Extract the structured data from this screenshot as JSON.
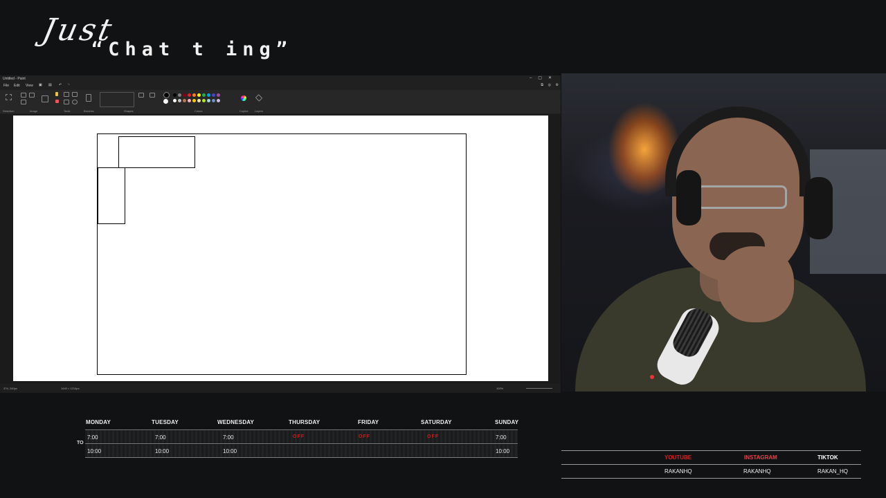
{
  "overlay": {
    "title_script": "Just",
    "title_main": "“Chat t ing”"
  },
  "paint": {
    "window_title": "Untitled - Paint",
    "menu": [
      "File",
      "Edit",
      "View"
    ],
    "ribbon_groups": [
      "Selection",
      "Image",
      "Tools",
      "Brushes",
      "Shapes",
      "Colors",
      "Copilot",
      "Layers"
    ],
    "status_position": "374, 240px",
    "status_size": "1440 × 1214px",
    "zoom": "100%",
    "palette": [
      "#000000",
      "#7f7f7f",
      "#880015",
      "#ed1c24",
      "#ff7f27",
      "#fff200",
      "#22b14c",
      "#00a2e8",
      "#3f48cc",
      "#a349a4",
      "#ffffff",
      "#c3c3c3",
      "#b97a57",
      "#ffaec9",
      "#ffc90e",
      "#efe4b0",
      "#b5e61d",
      "#99d9ea",
      "#7092be",
      "#c8bfe7"
    ]
  },
  "schedule": {
    "days": [
      "MONDAY",
      "TUESDAY",
      "WEDNESDAY",
      "THURSDAY",
      "FRIDAY",
      "SATURDAY",
      "SUNDAY"
    ],
    "to_label": "TO",
    "start_times": [
      "7:00",
      "7:00",
      "7:00",
      "OFF",
      "OFF",
      "OFF",
      "7:00"
    ],
    "end_times": [
      "10:00",
      "10:00",
      "10:00",
      "",
      "",
      "",
      "10:00"
    ],
    "off_color": "#d21b1b"
  },
  "socials": {
    "platforms": [
      "YOUTUBE",
      "INSTAGRAM",
      "TIKTOK"
    ],
    "handles": [
      "RAKANHQ",
      "RAKANHQ",
      "RAKAN_HQ"
    ],
    "platform_colors": [
      "#d62020",
      "#e5414a",
      "#ffffff"
    ]
  }
}
